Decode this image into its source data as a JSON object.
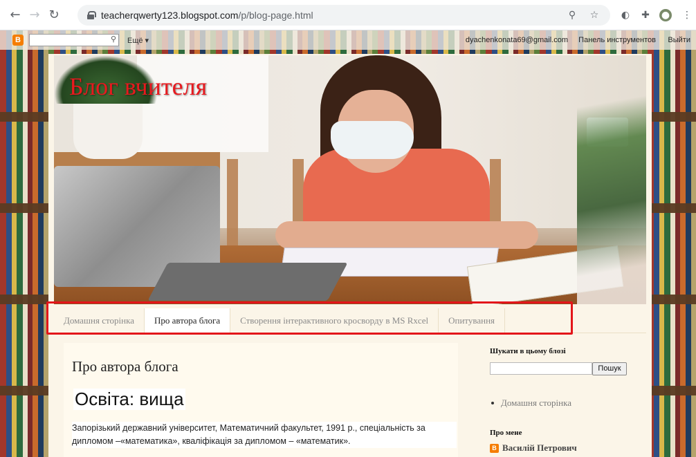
{
  "browser": {
    "url_host": "teacherqwerty123.blogspot.com",
    "url_path": "/p/blog-page.html",
    "icons": [
      "back-icon",
      "forward-icon",
      "reload-icon",
      "lock-icon",
      "zoom-icon",
      "star-icon",
      "extension-icon",
      "puzzle-icon",
      "profile-icon",
      "menu-icon"
    ]
  },
  "navbar": {
    "logo_letter": "B",
    "more_label": "Ещё ▾",
    "email": "dyachenkonata69@gmail.com",
    "dashboard_label": "Панель инструментов",
    "exit_label": "Выйти"
  },
  "blog": {
    "title": "Блог вчителя"
  },
  "tabs": [
    {
      "label": "Домашня сторінка",
      "active": false
    },
    {
      "label": "Про автора блога",
      "active": true
    },
    {
      "label": "Створення інтерактивного кросворду в MS Rxcel",
      "active": false
    },
    {
      "label": "Опитування",
      "active": false
    }
  ],
  "post": {
    "title": "Про автора блога",
    "heading": "Освіта: вища",
    "body": "Запорізький державний університет, Математичний факультет, 1991 р., спеціальність за дипломом –«математика», кваліфікація за дипломом – «математик»."
  },
  "sidebar": {
    "search_heading": "Шукати в цьому блозі",
    "search_button": "Пошук",
    "link_home": "Домашня сторінка",
    "about_heading": "Про мене",
    "profile_name": "Василій Петрович"
  },
  "colors": {
    "blog_title": "#e8191e",
    "highlight": "#e3151a",
    "content_bg": "#fbf5e8"
  }
}
